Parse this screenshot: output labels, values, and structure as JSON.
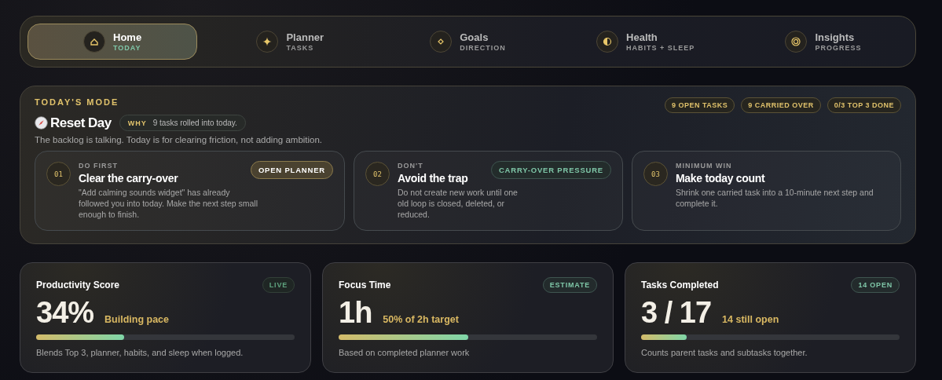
{
  "nav": [
    {
      "label": "Home",
      "sublabel": "TODAY",
      "selected": true
    },
    {
      "label": "Planner",
      "sublabel": "TASKS",
      "selected": false
    },
    {
      "label": "Goals",
      "sublabel": "DIRECTION",
      "selected": false
    },
    {
      "label": "Health",
      "sublabel": "HABITS + SLEEP",
      "selected": false
    },
    {
      "label": "Insights",
      "sublabel": "PROGRESS",
      "selected": false
    }
  ],
  "mode": {
    "eyebrow": "TODAY'S MODE",
    "title": "Reset Day",
    "why_label": "WHY",
    "why_text": "9 tasks rolled into today.",
    "subtitle": "The backlog is talking. Today is for clearing friction, not adding ambition.",
    "chips": [
      "9 OPEN TASKS",
      "9 CARRIED OVER",
      "0/3 TOP 3 DONE"
    ],
    "steps": [
      {
        "number": "01",
        "eyebrow": "DO FIRST",
        "title": "Clear the carry-over",
        "text": "\"Add calming sounds widget\" has already followed you into today. Make the next step small enough to finish.",
        "action": {
          "kind": "button",
          "label": "OPEN PLANNER"
        }
      },
      {
        "number": "02",
        "eyebrow": "DON'T",
        "title": "Avoid the trap",
        "text": "Do not create new work until one old loop is closed, deleted, or reduced.",
        "action": {
          "kind": "tag",
          "label": "CARRY-OVER PRESSURE"
        }
      },
      {
        "number": "03",
        "eyebrow": "MINIMUM WIN",
        "title": "Make today count",
        "text": "Shrink one carried task into a 10-minute next step and complete it."
      }
    ]
  },
  "stats": [
    {
      "title": "Productivity Score",
      "badge": "LIVE",
      "kind": "live",
      "value": "34%",
      "note": "Building pace",
      "level": 0.34,
      "caption": "Blends Top 3, planner, habits, and sleep when logged."
    },
    {
      "title": "Focus Time",
      "badge": "ESTIMATE",
      "kind": "estimate",
      "value": "1h",
      "note": "50% of 2h target",
      "level": 0.5,
      "caption": "Based on completed planner work"
    },
    {
      "title": "Tasks Completed",
      "badge": "14 OPEN",
      "kind": "count",
      "value": "3 / 17",
      "note": "14 still open",
      "level": 0.176,
      "caption": "Counts parent tasks and subtasks together."
    }
  ]
}
